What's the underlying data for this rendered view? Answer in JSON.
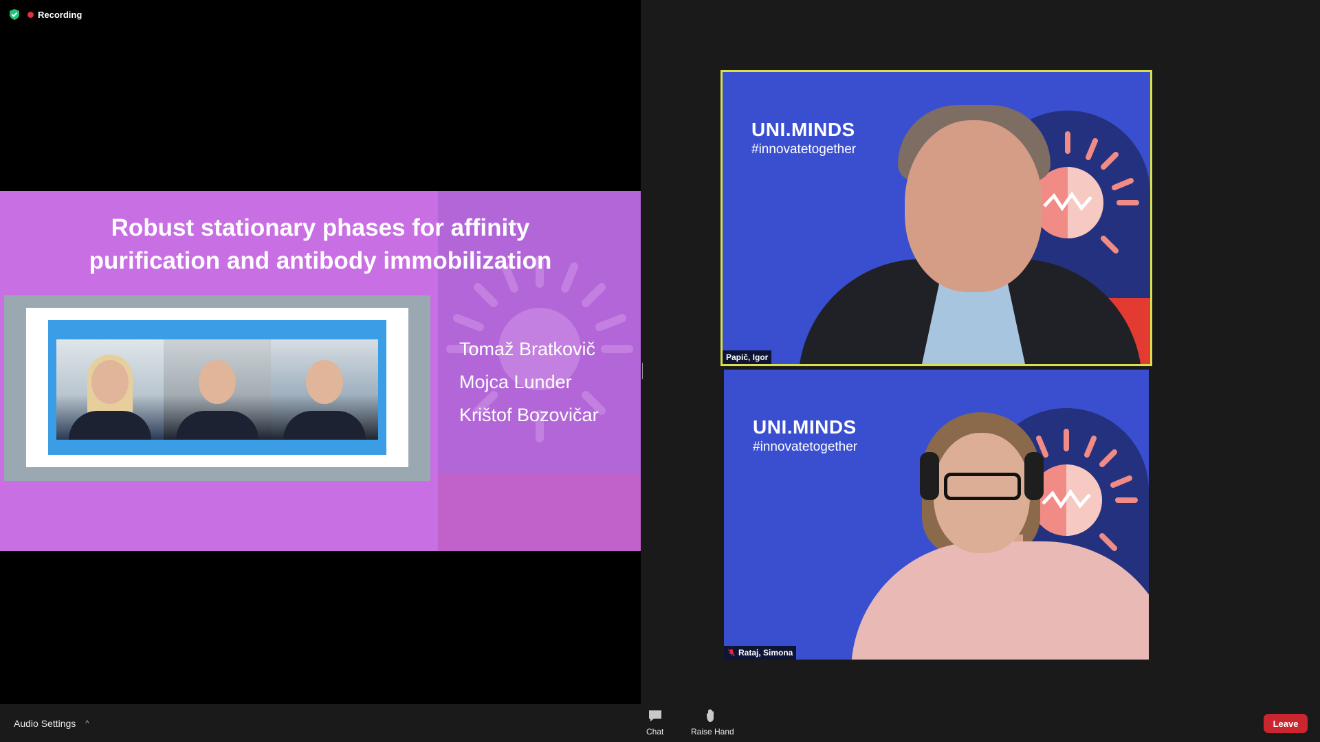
{
  "status": {
    "recording_label": "Recording"
  },
  "slide": {
    "title_line1": "Robust stationary phases for affinity",
    "title_line2": "purification and antibody immobilization",
    "authors": [
      "Tomaž Bratkovič",
      "Mojca Lunder",
      "Krištof Bozovičar"
    ]
  },
  "participants": [
    {
      "name": "Papič, Igor",
      "brand": "UNI.MINDS",
      "tag": "#innovatetogether",
      "active": true
    },
    {
      "name": "Rataj, Simona",
      "brand": "UNI.MINDS",
      "tag": "#innovatetogether",
      "muted": true
    }
  ],
  "toolbar": {
    "audio_settings": "Audio Settings",
    "chat": "Chat",
    "raise_hand": "Raise Hand",
    "leave": "Leave"
  },
  "colors": {
    "active_border": "#d9e04a",
    "leave": "#c9262f",
    "slide_bg": "#c86fe3",
    "tile_bg": "#3a4fd0"
  }
}
